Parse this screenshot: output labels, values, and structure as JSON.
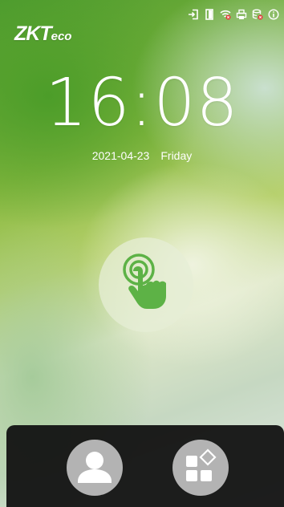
{
  "brand": {
    "logo_main": "ZKT",
    "logo_suffix": "eco"
  },
  "status_bar": {
    "icons": [
      "exit-icon",
      "door-icon",
      "wifi-disconnected-icon",
      "printer-icon",
      "database-icon",
      "info-icon"
    ]
  },
  "clock": {
    "time": "16:08",
    "date": "2021-04-23",
    "weekday": "Friday"
  },
  "touch_prompt": {
    "icon": "touch-finger-icon",
    "accent_color": "#5db246"
  },
  "dock": {
    "buttons": [
      {
        "icon": "user-icon"
      },
      {
        "icon": "menu-grid-icon"
      }
    ]
  },
  "colors": {
    "dock_bg": "#121212",
    "dock_button": "#b3b3b3",
    "text": "#ffffff"
  }
}
